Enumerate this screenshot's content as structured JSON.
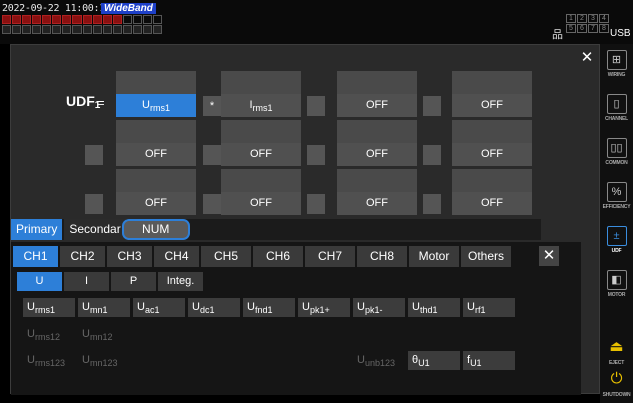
{
  "status": {
    "datetime": "2022-09-22 11:00:17",
    "mode_badge": "WideBand",
    "net_grid": [
      "1",
      "2",
      "3",
      "4",
      "5",
      "6",
      "7",
      "8"
    ],
    "usb": "USB"
  },
  "sidebar": {
    "items": [
      {
        "label": "WIRING",
        "icon": "wiring-icon",
        "glyph": "⊞"
      },
      {
        "label": "CHANNEL",
        "icon": "channel-icon",
        "glyph": "▯"
      },
      {
        "label": "COMMON",
        "icon": "common-icon",
        "glyph": "▯▯"
      },
      {
        "label": "EFFICIENCY",
        "icon": "efficiency-icon",
        "glyph": "%"
      },
      {
        "label": "UDF",
        "icon": "udf-icon",
        "glyph": "±"
      },
      {
        "label": "MOTOR",
        "icon": "motor-icon",
        "glyph": "◧"
      },
      {
        "label": "EJECT",
        "icon": "eject-icon",
        "glyph": "⏏"
      },
      {
        "label": "SHUTDOWN",
        "icon": "shutdown-icon",
        "glyph": "⏻"
      }
    ]
  },
  "udf": {
    "name": "UDF",
    "index": "1",
    "equals": "=",
    "row1": {
      "slot1": {
        "base": "U",
        "sub": "rms1"
      },
      "op1": "*",
      "slot2": {
        "base": "I",
        "sub": "rms1"
      },
      "slot3": "OFF",
      "slot4": "OFF"
    },
    "row2": [
      "OFF",
      "OFF",
      "OFF",
      "OFF"
    ],
    "row3": [
      "OFF",
      "OFF",
      "OFF",
      "OFF"
    ]
  },
  "mode_tabs": [
    {
      "label": "Primary"
    },
    {
      "label": "Secondar"
    },
    {
      "label": "NUM"
    }
  ],
  "channel_tabs": [
    "CH1",
    "CH2",
    "CH3",
    "CH4",
    "CH5",
    "CH6",
    "CH7",
    "CH8",
    "Motor",
    "Others"
  ],
  "quantity_tabs": [
    "U",
    "I",
    "P",
    "Integ."
  ],
  "items": {
    "row1": [
      {
        "base": "U",
        "sub": "rms1"
      },
      {
        "base": "U",
        "sub": "mn1"
      },
      {
        "base": "U",
        "sub": "ac1"
      },
      {
        "base": "U",
        "sub": "dc1"
      },
      {
        "base": "U",
        "sub": "fnd1"
      },
      {
        "base": "U",
        "sub": "pk1+"
      },
      {
        "base": "U",
        "sub": "pk1-"
      },
      {
        "base": "U",
        "sub": "thd1"
      },
      {
        "base": "U",
        "sub": "rf1"
      }
    ],
    "row2": [
      {
        "base": "U",
        "sub": "rms12"
      },
      {
        "base": "U",
        "sub": "mn12"
      }
    ],
    "row3": [
      {
        "base": "U",
        "sub": "rms123"
      },
      {
        "base": "U",
        "sub": "mn123"
      },
      {
        "base": "U",
        "sub": "unb123"
      },
      {
        "base": "θ",
        "sub": "U1"
      },
      {
        "base": "f",
        "sub": "U1"
      }
    ]
  },
  "colors": {
    "accent": "#2d7fd8",
    "panel": "#2a2a2a"
  }
}
